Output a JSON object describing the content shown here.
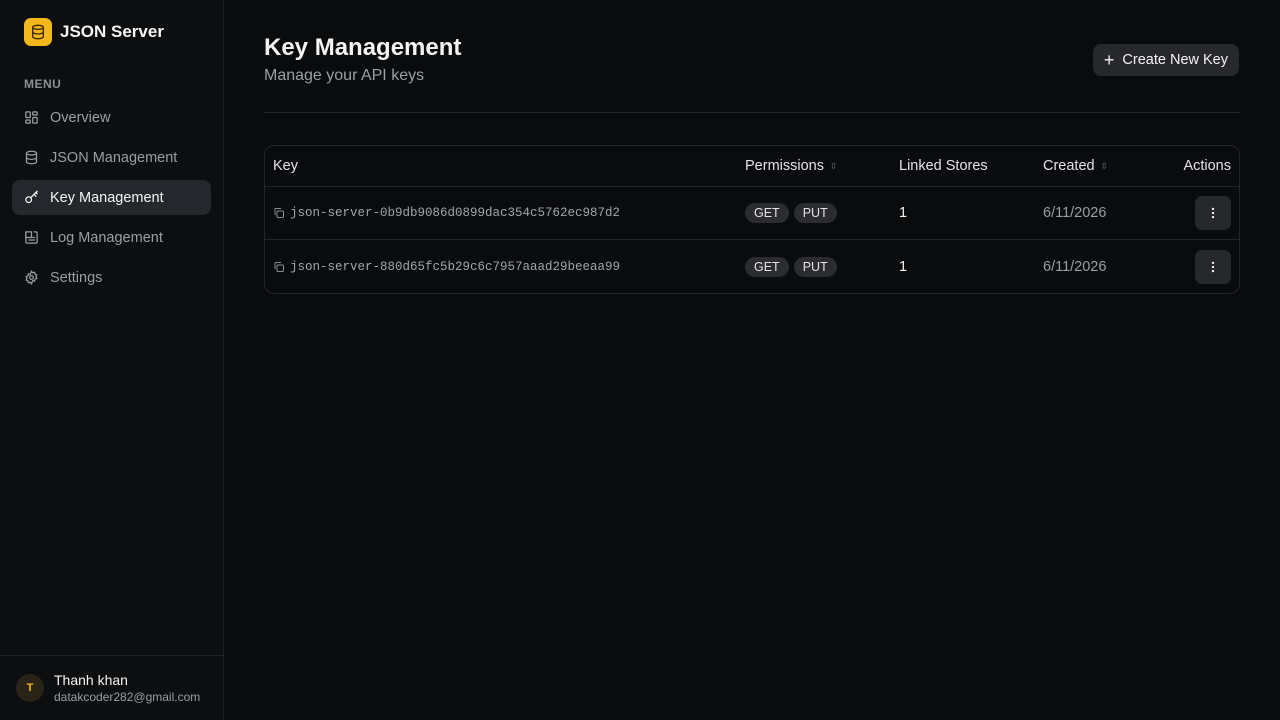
{
  "sidebar": {
    "brand": "JSON Server",
    "menu_label": "MENU",
    "items": [
      {
        "label": "Overview",
        "icon": "grid-icon"
      },
      {
        "label": "JSON Management",
        "icon": "database-icon"
      },
      {
        "label": "Key Management",
        "icon": "key-icon",
        "active": true
      },
      {
        "label": "Log Management",
        "icon": "log-icon"
      },
      {
        "label": "Settings",
        "icon": "gear-icon"
      }
    ],
    "user": {
      "initial": "T",
      "name": "Thanh khan",
      "email": "datakcoder282@gmail.com"
    }
  },
  "header": {
    "title": "Key Management",
    "subtitle": "Manage your API keys",
    "create_button": "Create New Key"
  },
  "table": {
    "columns": {
      "key": "Key",
      "permissions": "Permissions",
      "linked": "Linked Stores",
      "created": "Created",
      "actions": "Actions"
    },
    "rows": [
      {
        "key": "json-server-0b9db9086d0899dac354c5762ec987d2",
        "perm1": "GET",
        "perm2": "PUT",
        "linked": "1",
        "created": "6/11/2026"
      },
      {
        "key": "json-server-880d65fc5b29c6c7957aaad29beeaa99",
        "perm1": "GET",
        "perm2": "PUT",
        "linked": "1",
        "created": "6/11/2026"
      }
    ]
  },
  "colors": {
    "accent": "#f5b81c",
    "background": "#0a0b0d",
    "active_nav": "#24282d"
  }
}
